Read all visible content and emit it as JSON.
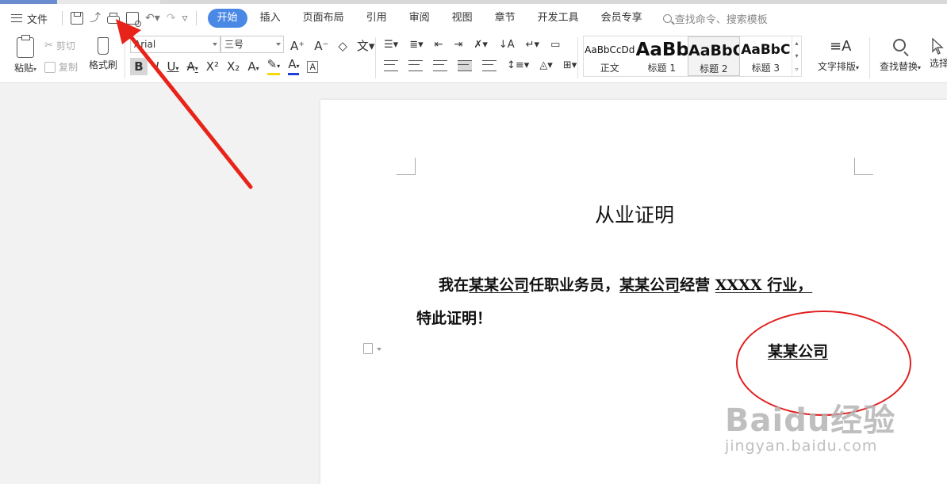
{
  "menubar": {
    "file_label": "文件",
    "tabs": [
      {
        "label": "开始",
        "active": true
      },
      {
        "label": "插入"
      },
      {
        "label": "页面布局"
      },
      {
        "label": "引用"
      },
      {
        "label": "审阅"
      },
      {
        "label": "视图"
      },
      {
        "label": "章节"
      },
      {
        "label": "开发工具"
      },
      {
        "label": "会员专享"
      }
    ],
    "search_placeholder": "查找命令、搜索模板"
  },
  "ribbon": {
    "paste_label": "粘贴",
    "cut_label": "剪切",
    "copy_label": "复制",
    "format_painter_label": "格式刷",
    "font_name": "Arial",
    "font_size": "三号",
    "styles": [
      {
        "preview": "AaBbCcDd",
        "label": "正文"
      },
      {
        "preview": "AaBb",
        "label": "标题 1"
      },
      {
        "preview": "AaBbC",
        "label": "标题 2"
      },
      {
        "preview": "AaBbC",
        "label": "标题 3"
      }
    ],
    "text_layout_label": "文字排版",
    "find_replace_label": "查找替换",
    "select_label": "选择"
  },
  "document": {
    "title": "从业证明",
    "line1": {
      "p1": "我在",
      "company1": "某某公司",
      "p2": "任职业务员，",
      "company2": "某某公司",
      "p3": "经营 ",
      "industry": "XXXX 行业，"
    },
    "line2": "特此证明！",
    "signature": "某某公司"
  },
  "watermark": {
    "brand": "Baidu经验",
    "url": "jingyan.baidu.com"
  },
  "colors": {
    "accent": "#4a88e6",
    "annotation": "#e02020"
  }
}
